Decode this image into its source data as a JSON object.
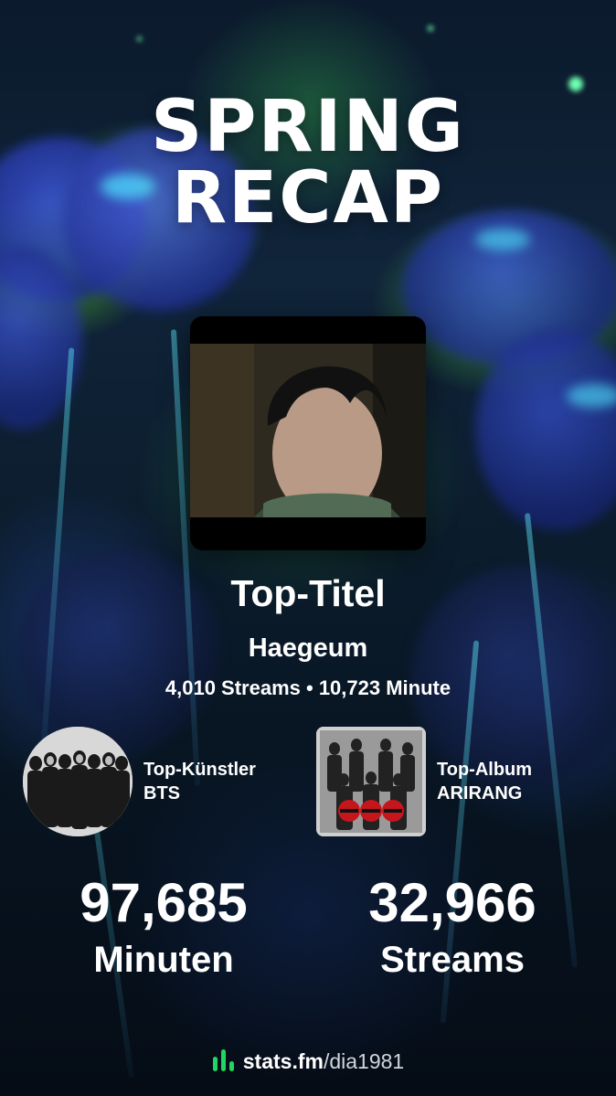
{
  "header": {
    "title_line1": "SPRING",
    "title_line2": "RECAP"
  },
  "top_track": {
    "heading": "Top-Titel",
    "name": "Haegeum",
    "stats": "4,010 Streams • 10,723 Minute"
  },
  "top_artist": {
    "label": "Top-Künstler",
    "name": "BTS"
  },
  "top_album": {
    "label": "Top-Album",
    "name": "ARIRANG"
  },
  "totals": {
    "minutes_value": "97,685",
    "minutes_label": "Minuten",
    "streams_value": "32,966",
    "streams_label": "Streams"
  },
  "footer": {
    "brand": "stats.fm",
    "username": "/dia1981",
    "logo_icon": "bar-chart-icon"
  },
  "colors": {
    "accent_green": "#1ed760",
    "text": "#ffffff"
  }
}
